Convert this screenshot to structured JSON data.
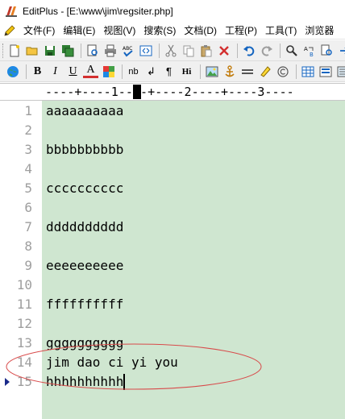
{
  "window": {
    "title": "EditPlus - [E:\\www\\jim\\regsiter.php]"
  },
  "menu": {
    "items": [
      "文件(F)",
      "编辑(E)",
      "视图(V)",
      "搜索(S)",
      "文档(D)",
      "工程(P)",
      "工具(T)",
      "浏览器"
    ]
  },
  "toolbar1": {
    "icons": [
      "new-file-icon",
      "open-folder-icon",
      "save-icon",
      "save-all-icon",
      "print-preview-icon",
      "print-icon",
      "spell-check-icon",
      "browser-icon",
      "cut-icon",
      "copy-icon",
      "paste-icon",
      "delete-icon",
      "undo-icon",
      "redo-icon",
      "find-icon",
      "replace-icon",
      "find-in-files-icon",
      "goto-icon"
    ]
  },
  "toolbar2": {
    "icons": [
      "globe-icon",
      "bold-icon",
      "italic-icon",
      "underline-icon",
      "font-color-icon",
      "color-palette-icon",
      "nbsp-icon",
      "line-break-icon",
      "paragraph-icon",
      "heading-icon",
      "image-icon",
      "anchor-icon",
      "horizontal-rule-icon",
      "highlight-icon",
      "copyright-icon",
      "table-icon",
      "form-icon",
      "list-icon"
    ],
    "labels": {
      "bold": "B",
      "italic": "I",
      "underline": "U",
      "font_color": "A",
      "nbsp": "nb",
      "line_break": "↲",
      "paragraph": "¶",
      "heading": "Hi"
    }
  },
  "ruler": {
    "text": "----+----1----+----2----+----3----"
  },
  "editor": {
    "line_numbers": [
      "1",
      "2",
      "3",
      "4",
      "5",
      "6",
      "7",
      "8",
      "9",
      "10",
      "11",
      "12",
      "13",
      "14",
      "15"
    ],
    "lines": [
      "aaaaaaaaaa",
      "",
      "bbbbbbbbbb",
      "",
      "cccccccccc",
      "",
      "dddddddddd",
      "",
      "eeeeeeeeee",
      "",
      "ffffffffff",
      "",
      "gggggggggg",
      "jim dao ci yi you",
      "hhhhhhhhhh"
    ],
    "current_line": 15,
    "text_bg_color": "#cfe6d0",
    "annotation_color": "#d84a4a"
  }
}
